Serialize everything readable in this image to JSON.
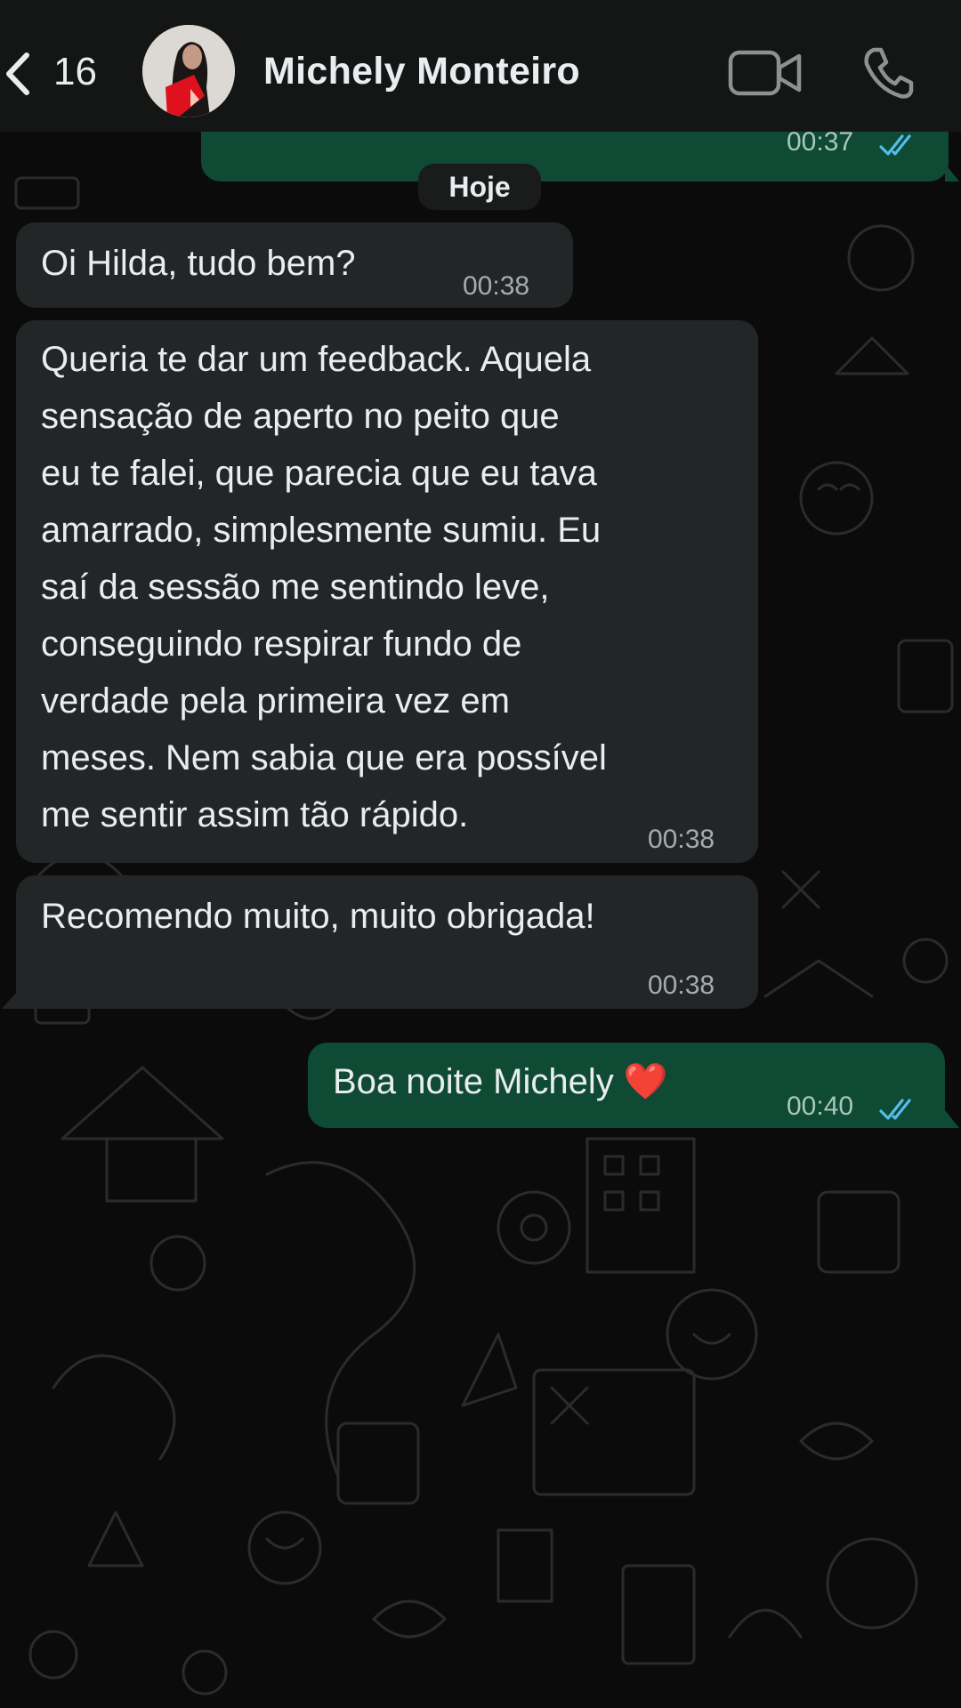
{
  "header": {
    "back_count": "16",
    "contact_name": "Michely Monteiro"
  },
  "icons": {
    "back": "chevron-left-icon",
    "video": "video-camera-icon",
    "call": "phone-icon",
    "read_receipt": "double-check-icon"
  },
  "colors": {
    "header_bg": "#141615",
    "incoming_bubble": "#232626",
    "outgoing_bubble": "#0f4a35",
    "read_tick": "#53bdeb",
    "avatar_accent": "#e0111e"
  },
  "chat": {
    "date_chip": "Hoje",
    "messages": [
      {
        "direction": "out",
        "text": "",
        "time": "00:37",
        "read": true
      },
      {
        "direction": "in",
        "text": "Oi Hilda, tudo bem?",
        "time": "00:38"
      },
      {
        "direction": "in",
        "text": "Queria te dar um feedback. Aquela\nsensação de aperto no peito que\neu te falei, que parecia que eu tava\namarrado, simplesmente sumiu. Eu\nsaí da sessão me sentindo leve,\nconseguindo respirar fundo de\nverdade pela primeira vez em\nmeses. Nem sabia que era possível\nme sentir assim tão rápido.",
        "time": "00:38"
      },
      {
        "direction": "in",
        "text": "Recomendo muito, muito obrigada!",
        "time": "00:38"
      },
      {
        "direction": "out",
        "text": "Boa noite Michely ❤️",
        "time": "00:40",
        "read": true
      }
    ]
  }
}
